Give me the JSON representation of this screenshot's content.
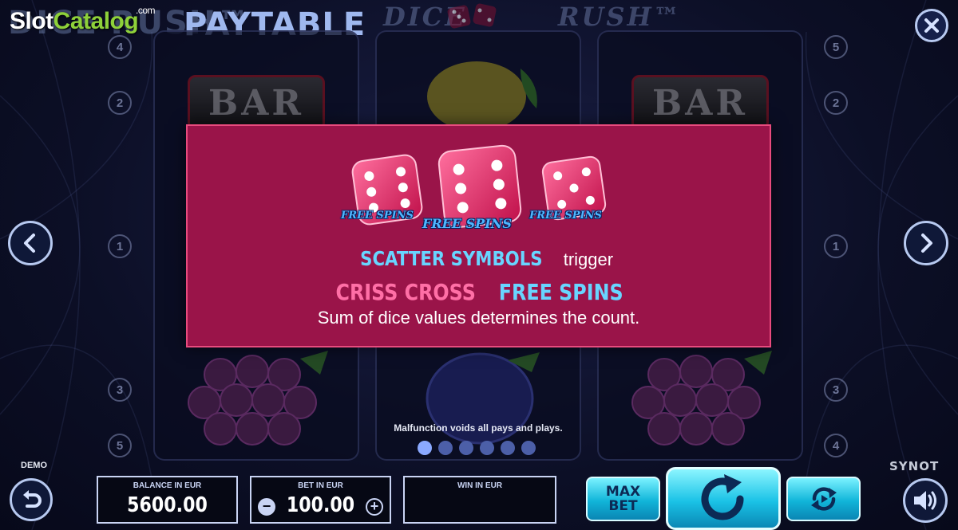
{
  "watermark": {
    "slot": "Slot",
    "catalog": "Catalog",
    "com": ".com"
  },
  "header": {
    "game_title": "DICE RUSH™",
    "paytable_title": "PAYTABLE",
    "logo_text_left": "DICE",
    "logo_text_right": "RUSH™"
  },
  "reels": {
    "bar_label": "BAR",
    "left_line_numbers": [
      "4",
      "2",
      "1",
      "3",
      "5"
    ],
    "right_line_numbers": [
      "5",
      "2",
      "1",
      "3",
      "4"
    ]
  },
  "panel": {
    "free_spins_label": "FREE SPINS",
    "line1": {
      "highlight": "SCATTER SYMBOLS",
      "rest": " trigger"
    },
    "line2": {
      "pink": "CRISS CROSS",
      "blue": " FREE SPINS"
    },
    "line3": "Sum of dice values determines the count."
  },
  "disclaimer": "Malfunction voids all pays and plays.",
  "pagination": {
    "pages": 6,
    "active_page": 1
  },
  "bottom": {
    "demo": "DEMO",
    "balance_label": "BALANCE IN EUR",
    "balance_value": "5600.00",
    "bet_label": "BET IN EUR",
    "bet_value": "100.00",
    "win_label": "WIN IN EUR",
    "win_value": "",
    "maxbet_line1": "MAX",
    "maxbet_line2": "BET",
    "brand": "SYNOT"
  },
  "icons": {
    "close": "close-icon",
    "prev": "chevron-left-icon",
    "next": "chevron-right-icon",
    "undo": "undo-icon",
    "spin": "spin-icon",
    "autoplay": "autoplay-icon",
    "sound": "speaker-icon"
  },
  "colors": {
    "panel": "#9a1449",
    "panel_border": "#e84b7e",
    "accent_blue": "#68d5ff",
    "accent_pink": "#ff6fa6",
    "button_cyan": "#11b5d9"
  }
}
